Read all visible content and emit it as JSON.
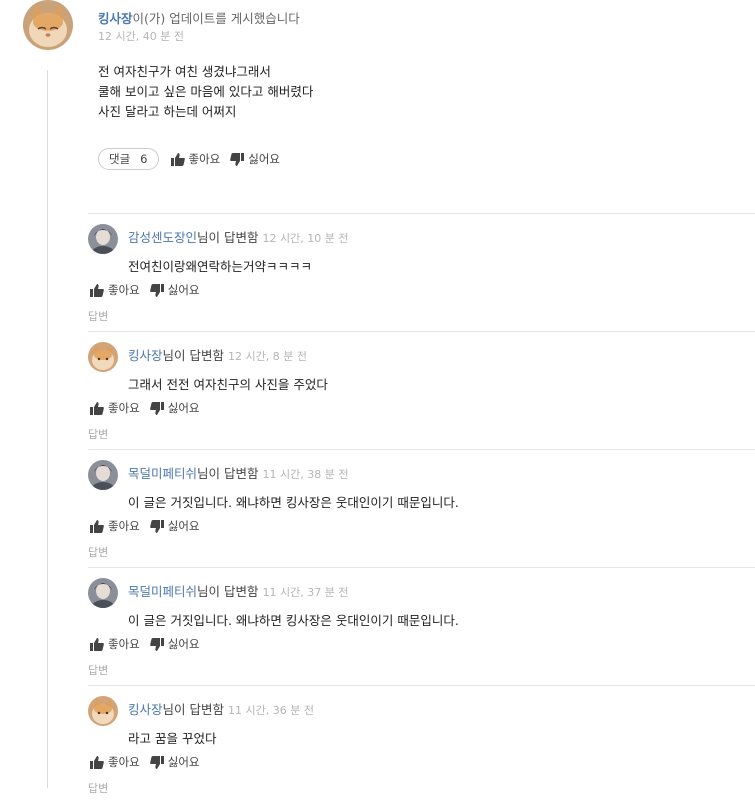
{
  "post": {
    "author": "킹사장",
    "action_text": "이(가) 업데이트를 게시했습니다",
    "time": "12 시간, 40 분 전",
    "lines": [
      "전 여자친구가 여친 생겼냐그래서",
      "쿨해 보이고 싶은 마음에 있다고 해버렸다",
      "사진 달라고 하는데 어쩌지"
    ],
    "comment_label": "댓글",
    "comment_count": "6",
    "like_label": "좋아요",
    "dislike_label": "싫어요"
  },
  "replies": [
    {
      "author": "감성센도장인",
      "suffix": "님이 답변함",
      "time": "12 시간, 10 분 전",
      "text": "전여친이랑왜연락하는거약ㅋㅋㅋㅋ",
      "like_label": "좋아요",
      "dislike_label": "싫어요",
      "answer_label": "답변",
      "avatar": "person-avatar"
    },
    {
      "author": "킹사장",
      "suffix": "님이 답변함",
      "time": "12 시간, 8 분 전",
      "text": "그래서 전전 여자친구의 사진을 주었다",
      "like_label": "좋아요",
      "dislike_label": "싫어요",
      "answer_label": "답변",
      "avatar": "cat-avatar"
    },
    {
      "author": "목덜미페티쉬",
      "suffix": "님이 답변함",
      "time": "11 시간, 38 분 전",
      "text": "이 글은 거짓입니다. 왜냐하면 킹사장은 웃대인이기 때문입니다.",
      "like_label": "좋아요",
      "dislike_label": "싫어요",
      "answer_label": "답변",
      "avatar": "person-avatar"
    },
    {
      "author": "목덜미페티쉬",
      "suffix": "님이 답변함",
      "time": "11 시간, 37 분 전",
      "text": "이 글은 거짓입니다. 왜냐하면 킹사장은 웃대인이기 때문입니다.",
      "like_label": "좋아요",
      "dislike_label": "싫어요",
      "answer_label": "답변",
      "avatar": "person-avatar"
    },
    {
      "author": "킹사장",
      "suffix": "님이 답변함",
      "time": "11 시간, 36 분 전",
      "text": "라고 꿈을 꾸었다",
      "like_label": "좋아요",
      "dislike_label": "싫어요",
      "answer_label": "답변",
      "avatar": "cat-avatar"
    }
  ]
}
